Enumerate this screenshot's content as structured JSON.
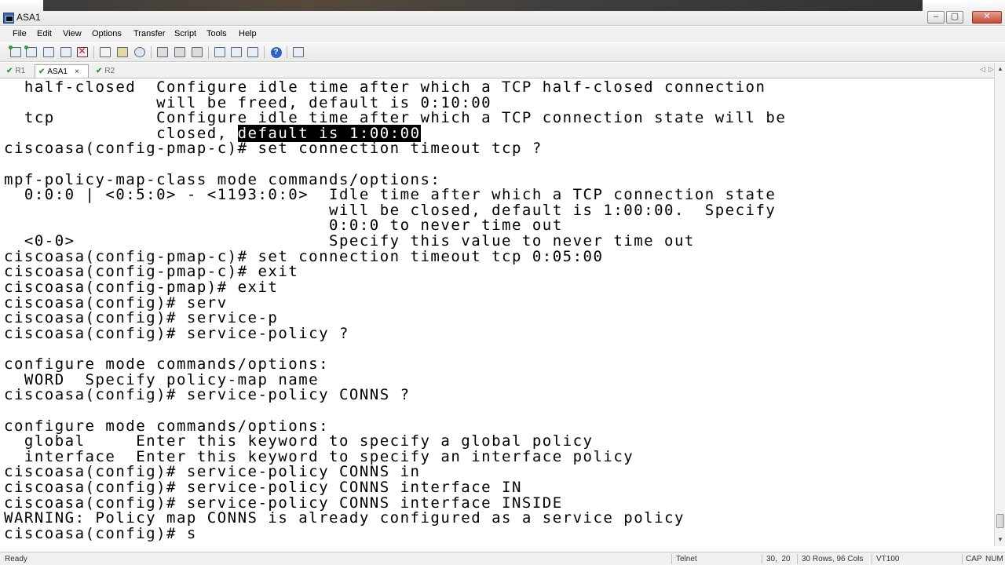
{
  "window": {
    "title": "ASA1",
    "controls": {
      "minimize": "–",
      "maximize": "▢",
      "close": "✕"
    }
  },
  "menu": [
    "File",
    "Edit",
    "View",
    "Options",
    "Transfer",
    "Script",
    "Tools",
    "Help"
  ],
  "toolbar_icons": [
    "connect-icon",
    "quick-connect-icon",
    "connect-tab-icon",
    "reconnect-icon",
    "disconnect-icon",
    "copy-icon",
    "paste-icon",
    "find-icon",
    "print-icon",
    "print-selection-icon",
    "print-setup-icon",
    "session-options-icon",
    "global-options-icon",
    "keymap-icon",
    "help-icon",
    "lock-icon"
  ],
  "tabs": [
    {
      "label": "R1",
      "active": false,
      "connected": true
    },
    {
      "label": "ASA1",
      "active": true,
      "connected": true,
      "close": "×"
    },
    {
      "label": "R2",
      "active": false,
      "connected": true
    }
  ],
  "tab_scroll": {
    "left": "◁",
    "right": "▷"
  },
  "terminal": {
    "lines": [
      {
        "text": "  half-closed  Configure idle time after which a TCP half-closed connection"
      },
      {
        "text": "               will be freed, default is 0:10:00"
      },
      {
        "text": "  tcp          Configure idle time after which a TCP connection state will be"
      },
      {
        "text": "               closed, ",
        "highlight": "default is 1:00:00"
      },
      {
        "text": "ciscoasa(config-pmap-c)# set connection timeout tcp ?"
      },
      {
        "text": ""
      },
      {
        "text": "mpf-policy-map-class mode commands/options:"
      },
      {
        "text": "  0:0:0 | <0:5:0> - <1193:0:0>  Idle time after which a TCP connection state"
      },
      {
        "text": "                                will be closed, default is 1:00:00.  Specify"
      },
      {
        "text": "                                0:0:0 to never time out"
      },
      {
        "text": "  <0-0>                         Specify this value to never time out"
      },
      {
        "text": "ciscoasa(config-pmap-c)# set connection timeout tcp 0:05:00"
      },
      {
        "text": "ciscoasa(config-pmap-c)# exit"
      },
      {
        "text": "ciscoasa(config-pmap)# exit"
      },
      {
        "text": "ciscoasa(config)# serv"
      },
      {
        "text": "ciscoasa(config)# service-p"
      },
      {
        "text": "ciscoasa(config)# service-policy ?"
      },
      {
        "text": ""
      },
      {
        "text": "configure mode commands/options:"
      },
      {
        "text": "  WORD  Specify policy-map name"
      },
      {
        "text": "ciscoasa(config)# service-policy CONNS ?"
      },
      {
        "text": ""
      },
      {
        "text": "configure mode commands/options:"
      },
      {
        "text": "  global     Enter this keyword to specify a global policy"
      },
      {
        "text": "  interface  Enter this keyword to specify an interface policy"
      },
      {
        "text": "ciscoasa(config)# service-policy CONNS in"
      },
      {
        "text": "ciscoasa(config)# service-policy CONNS interface IN"
      },
      {
        "text": "ciscoasa(config)# service-policy CONNS interface INSIDE"
      },
      {
        "text": "WARNING: Policy map CONNS is already configured as a service policy"
      },
      {
        "text": "ciscoasa(config)# s"
      }
    ]
  },
  "status": {
    "ready": "Ready",
    "protocol": "Telnet",
    "cursor": "30,  20",
    "size": "30 Rows, 96 Cols",
    "emulation": "VT100",
    "caps": "CAP",
    "num": "NUM"
  }
}
